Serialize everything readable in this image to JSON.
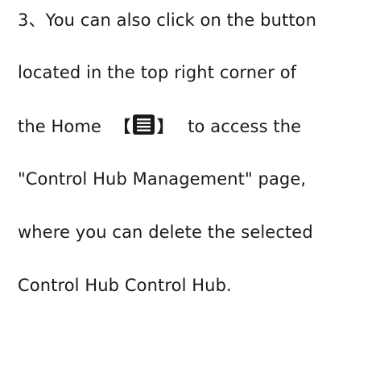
{
  "instruction": {
    "line1": "3、You can also click on the button",
    "line2": "located in the top right corner of",
    "line3_before": "the Home",
    "bracket_open": "【",
    "bracket_close": "】",
    "line3_after": "to access the",
    "line4": "\"Control Hub Management\" page,",
    "line5": "where you can delete the selected",
    "line6": "Control Hub Control Hub.",
    "menu_icon": "menu-icon"
  }
}
